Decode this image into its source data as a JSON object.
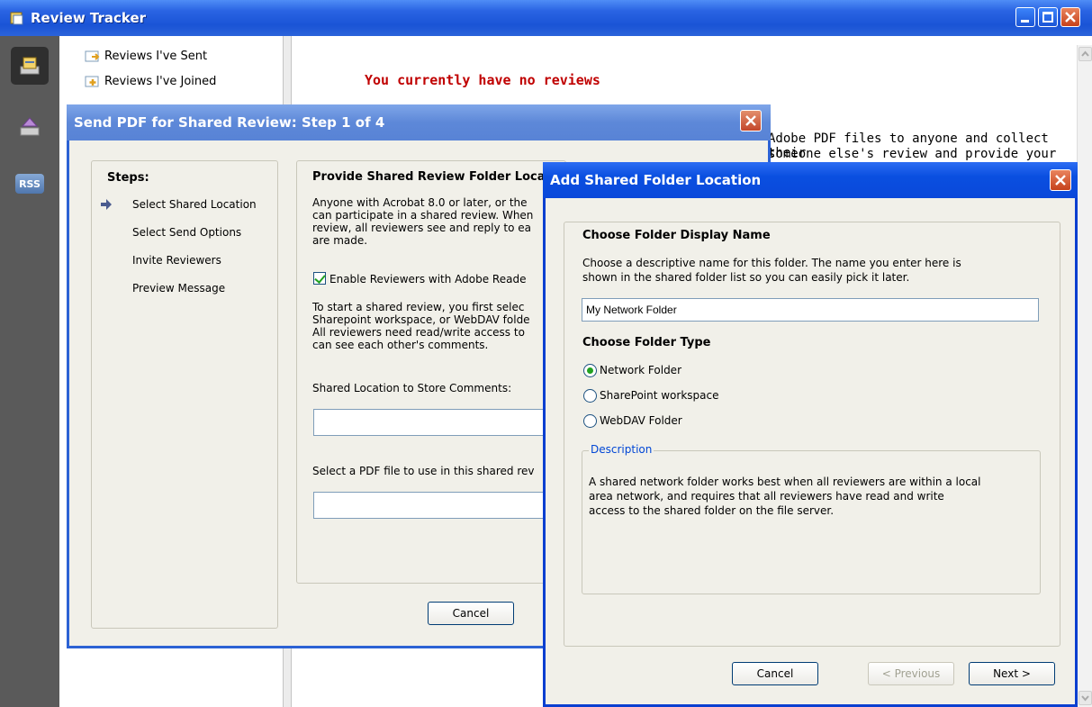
{
  "main_window": {
    "title": "Review Tracker",
    "sidebar": {
      "rss_label": "RSS"
    },
    "tree": [
      {
        "label": "Reviews I've Sent"
      },
      {
        "label": "Reviews I've Joined"
      }
    ],
    "content": {
      "empty_message": "You currently have no reviews",
      "background_lines": [
        "Adobe PDF files to anyone and collect their",
        "someone else's review and provide your"
      ]
    }
  },
  "dialog_send": {
    "title": "Send PDF for Shared Review: Step 1 of 4",
    "steps_label": "Steps:",
    "steps": [
      "Select Shared Location",
      "Select Send Options",
      "Invite Reviewers",
      "Preview Message"
    ],
    "current_step_index": 0,
    "heading": "Provide Shared Review Folder Loca",
    "para1": "Anyone with Acrobat 8.0 or later, or the\ncan participate in a shared review. When\nreview, all reviewers see and reply to ea\nare made.",
    "checkbox_label": "Enable Reviewers with Adobe Reade",
    "checkbox_checked": true,
    "para2": "To start a shared review, you first selec\nSharepoint workspace, or WebDAV folde\nAll reviewers need read/write access to\ncan see each other's comments.",
    "location_label": "Shared Location to Store Comments:",
    "location_value": "",
    "pdf_label": "Select a PDF file to use in this shared rev",
    "pdf_value": "",
    "cancel_label": "Cancel"
  },
  "dialog_add_folder": {
    "title": "Add Shared Folder Location",
    "display_name_heading": "Choose Folder Display Name",
    "display_name_desc": "Choose a descriptive name for this folder. The name you enter here is\nshown in the shared folder list so you can easily pick it later.",
    "display_name_value": "My Network Folder",
    "type_heading": "Choose Folder Type",
    "folder_types": [
      "Network Folder",
      "SharePoint workspace",
      "WebDAV Folder"
    ],
    "selected_type_index": 0,
    "description_legend": "Description",
    "description_text": "A shared network folder works best when all reviewers are within a local\narea network, and requires that all reviewers have read and write\naccess to the shared folder on the file server.",
    "cancel_label": "Cancel",
    "previous_label": "< Previous",
    "next_label": "Next >"
  }
}
